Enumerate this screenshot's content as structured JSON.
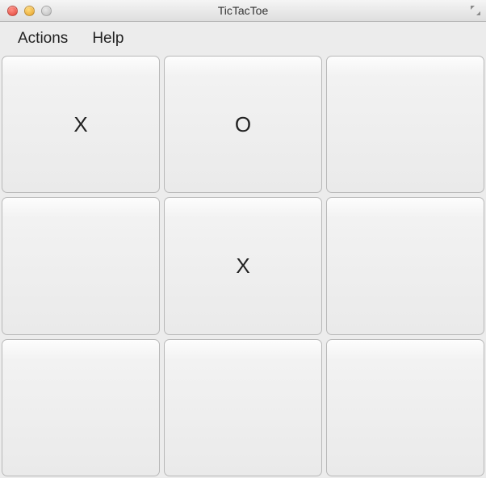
{
  "window": {
    "title": "TicTacToe"
  },
  "menubar": {
    "items": [
      "Actions",
      "Help"
    ]
  },
  "board": {
    "cells": [
      "X",
      "O",
      "",
      "",
      "X",
      "",
      "",
      "",
      ""
    ]
  }
}
